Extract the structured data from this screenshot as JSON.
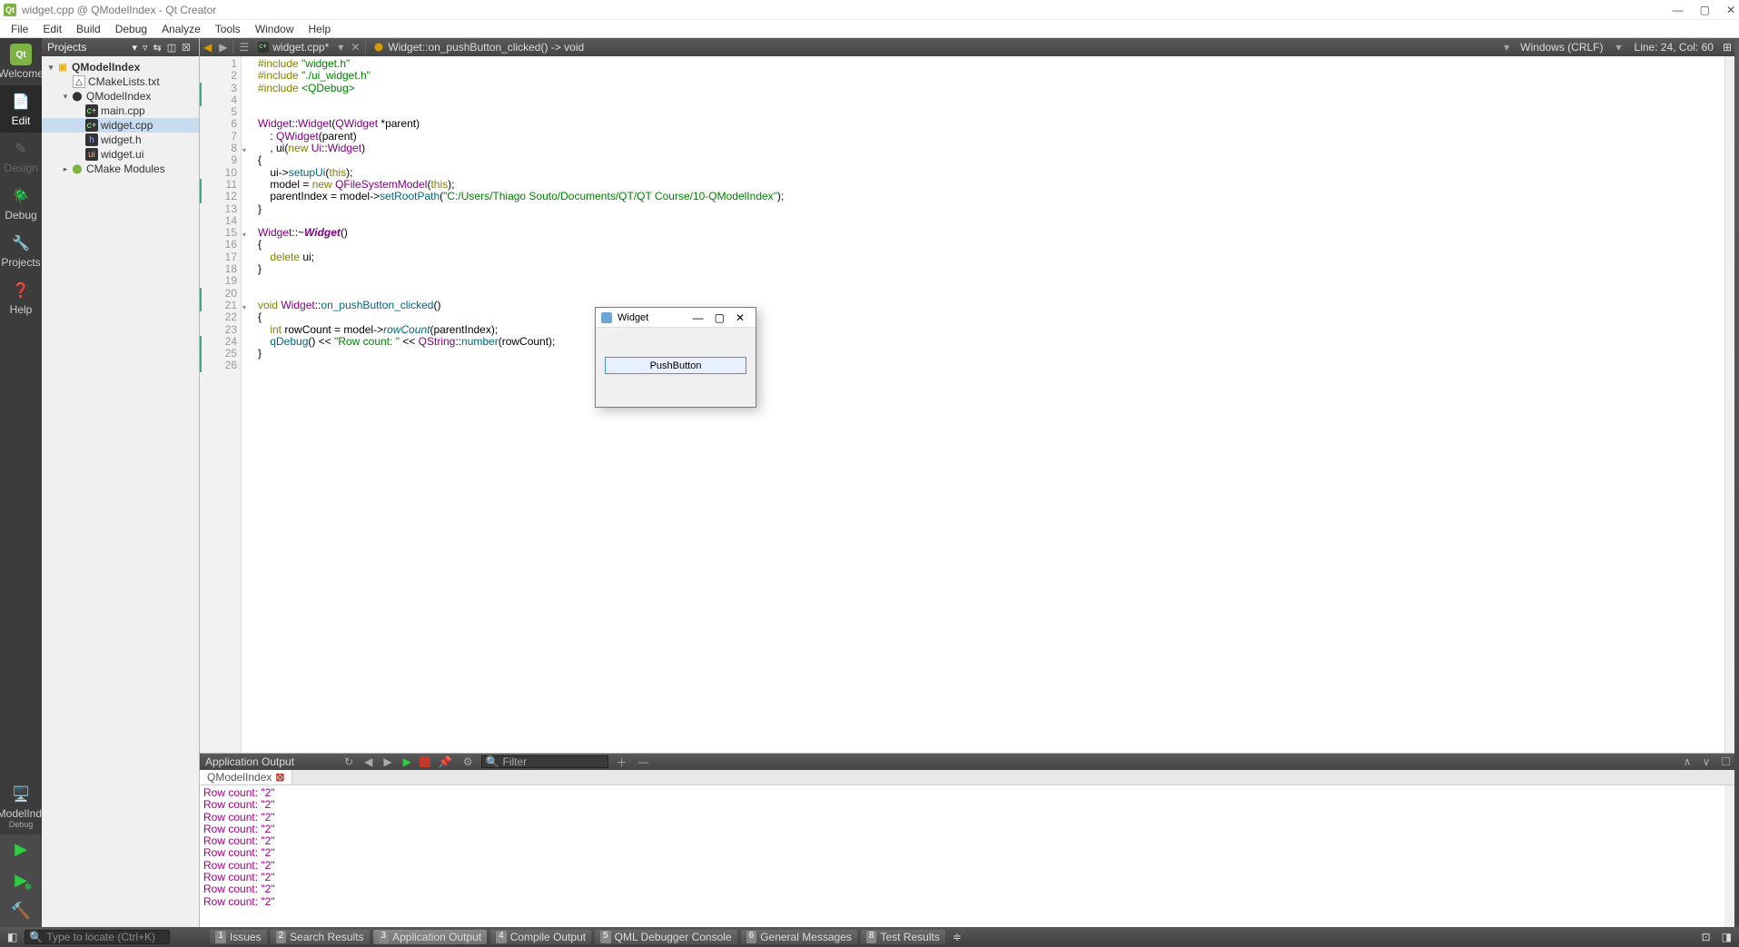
{
  "app": {
    "title": "widget.cpp @ QModelIndex - Qt Creator"
  },
  "menubar": [
    "File",
    "Edit",
    "Build",
    "Debug",
    "Analyze",
    "Tools",
    "Window",
    "Help"
  ],
  "leftbar": {
    "items": [
      {
        "label": "Welcome",
        "glyph": "Qt"
      },
      {
        "label": "Edit",
        "glyph": "☰"
      },
      {
        "label": "Design",
        "glyph": "✎"
      },
      {
        "label": "Debug",
        "glyph": "🐞"
      },
      {
        "label": "Projects",
        "glyph": "🔧"
      },
      {
        "label": "Help",
        "glyph": "❓"
      }
    ],
    "active": 1,
    "kit": "QModelIndex",
    "config": "Debug"
  },
  "sidebar": {
    "header": "Projects",
    "tree": {
      "root": "QModelIndex",
      "cmake": "CMakeLists.txt",
      "folder": "QModelIndex",
      "files": [
        {
          "name": "main.cpp",
          "type": "cpp"
        },
        {
          "name": "widget.cpp",
          "type": "cpp",
          "selected": true
        },
        {
          "name": "widget.h",
          "type": "h"
        },
        {
          "name": "widget.ui",
          "type": "ui"
        }
      ],
      "modules": "CMake Modules"
    }
  },
  "editor": {
    "tab_file": "widget.cpp*",
    "crumb": "Widget::on_pushButton_clicked() -> void",
    "encoding": "Windows (CRLF)",
    "position": "Line: 24, Col: 60",
    "lines": [
      {
        "n": 1,
        "html": "<span class='kw'>#include</span> <span class='str'>\"widget.h\"</span>"
      },
      {
        "n": 2,
        "html": "<span class='kw'>#include</span> <span class='str'>\"./ui_widget.h\"</span>"
      },
      {
        "n": 3,
        "html": "<span class='kw'>#include</span> <span class='str'>&lt;QDebug&gt;</span>",
        "mark": true
      },
      {
        "n": 4,
        "html": "",
        "mark": true
      },
      {
        "n": 5,
        "html": ""
      },
      {
        "n": 6,
        "html": "<span class='type'>Widget</span>::<span class='type'>Widget</span>(<span class='type'>QWidget</span> *parent)"
      },
      {
        "n": 7,
        "html": "    : <span class='type'>QWidget</span>(parent)"
      },
      {
        "n": 8,
        "html": "    , ui(<span class='kw'>new</span> <span class='type'>Ui</span>::<span class='type'>Widget</span>)",
        "fold": true
      },
      {
        "n": 9,
        "html": "{"
      },
      {
        "n": 10,
        "html": "    ui<span class='op'>-&gt;</span><span class='fn'>setupUi</span>(<span class='kw'>this</span>);"
      },
      {
        "n": 11,
        "html": "    model = <span class='kw'>new</span> <span class='type'>QFileSystemModel</span>(<span class='kw'>this</span>);",
        "mark": true
      },
      {
        "n": 12,
        "html": "    parentIndex = model<span class='op'>-&gt;</span><span class='fn'>setRootPath</span>(<span class='str'>\"C:/Users/Thiago Souto/Documents/QT/QT Course/10-QModelIndex\"</span>);",
        "mark": true
      },
      {
        "n": 13,
        "html": "}"
      },
      {
        "n": 14,
        "html": ""
      },
      {
        "n": 15,
        "html": "<span class='type'>Widget</span>::~<span class='type'><b><i>Widget</i></b></span>()",
        "fold": true
      },
      {
        "n": 16,
        "html": "{"
      },
      {
        "n": 17,
        "html": "    <span class='kw'>delete</span> ui;"
      },
      {
        "n": 18,
        "html": "}"
      },
      {
        "n": 19,
        "html": ""
      },
      {
        "n": 20,
        "html": "",
        "mark": true
      },
      {
        "n": 21,
        "html": "<span class='kw'>void</span> <span class='type'>Widget</span>::<span class='fn'>on_pushButton_clicked</span>()",
        "fold": true,
        "mark": true
      },
      {
        "n": 22,
        "html": "{"
      },
      {
        "n": 23,
        "html": "    <span class='kw'>int</span> rowCount = model<span class='op'>-&gt;</span><span class='fnit'>rowCount</span>(parentIndex);"
      },
      {
        "n": 24,
        "html": "    <span class='fn'>qDebug</span>() &lt;&lt; <span class='str'>\"Row count: \"</span> &lt;&lt; <span class='type'>QString</span>::<span class='fn'>number</span>(rowCount);",
        "mark": true
      },
      {
        "n": 25,
        "html": "}",
        "mark": true
      },
      {
        "n": 26,
        "html": "",
        "mark": true
      }
    ]
  },
  "output": {
    "title": "Application Output",
    "filter_placeholder": "Filter",
    "tab": "QModelIndex",
    "rows": [
      "Row count:  \"2\"",
      "Row count:  \"2\"",
      "Row count:  \"2\"",
      "Row count:  \"2\"",
      "Row count:  \"2\"",
      "Row count:  \"2\"",
      "Row count:  \"2\"",
      "Row count:  \"2\"",
      "Row count:  \"2\"",
      "Row count:  \"2\""
    ]
  },
  "statusbar": {
    "search_placeholder": "Type to locate (Ctrl+K)",
    "tabs": [
      {
        "n": "1",
        "label": "Issues"
      },
      {
        "n": "2",
        "label": "Search Results"
      },
      {
        "n": "3",
        "label": "Application Output",
        "active": true
      },
      {
        "n": "4",
        "label": "Compile Output"
      },
      {
        "n": "5",
        "label": "QML Debugger Console"
      },
      {
        "n": "6",
        "label": "General Messages"
      },
      {
        "n": "8",
        "label": "Test Results"
      }
    ]
  },
  "dialog": {
    "title": "Widget",
    "button": "PushButton"
  }
}
